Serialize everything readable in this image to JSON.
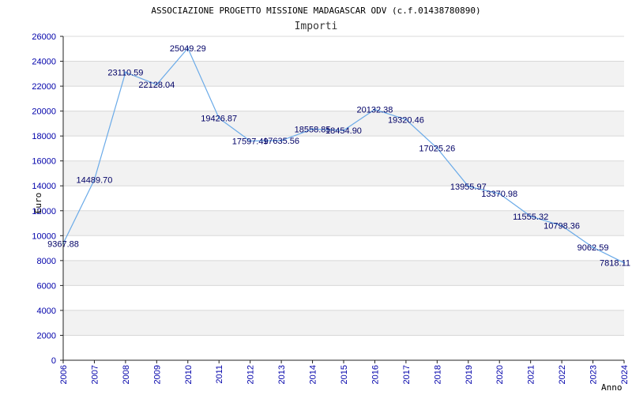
{
  "chart_data": {
    "type": "line",
    "title": "ASSOCIAZIONE PROGETTO MISSIONE MADAGASCAR ODV (c.f.01438780890)",
    "subtitle": "Importi",
    "xlabel": "Anno",
    "ylabel": "Euro",
    "ylim": [
      0,
      26000
    ],
    "y_ticks": [
      "0",
      "2000",
      "4000",
      "6000",
      "8000",
      "10000",
      "12000",
      "14000",
      "16000",
      "18000",
      "20000",
      "22000",
      "24000",
      "26000"
    ],
    "grid": "horizontal bands",
    "categories": [
      "2006",
      "2007",
      "2008",
      "2009",
      "2010",
      "2011",
      "2012",
      "2013",
      "2014",
      "2015",
      "2016",
      "2017",
      "2018",
      "2019",
      "2020",
      "2021",
      "2022",
      "2023",
      "2024"
    ],
    "series": [
      {
        "values": [
          9367.88,
          14489.7,
          23110.59,
          22128.04,
          25049.29,
          19426.87,
          17597.49,
          17635.56,
          18558.85,
          18454.9,
          20132.38,
          19320.46,
          17025.26,
          13955.97,
          13370.98,
          11555.32,
          10798.36,
          9062.59,
          7818.11
        ],
        "labels": [
          "9367.88",
          "14489.70",
          "23110.59",
          "22128.04",
          "25049.29",
          "19426.87",
          "17597.49",
          "17635.56",
          "18558.85",
          "18454.90",
          "20132.38",
          "19320.46",
          "17025.26",
          "13955.97",
          "13370.98",
          "11555.32",
          "10798.36",
          "9062.59",
          "7818.11"
        ],
        "color": "#6aaae8"
      }
    ],
    "colors": {
      "band": "#f2f2f2",
      "gridline": "#d8d8d8",
      "axis": "#222222",
      "tick_text": "#0000aa",
      "label_text": "#000066"
    }
  }
}
